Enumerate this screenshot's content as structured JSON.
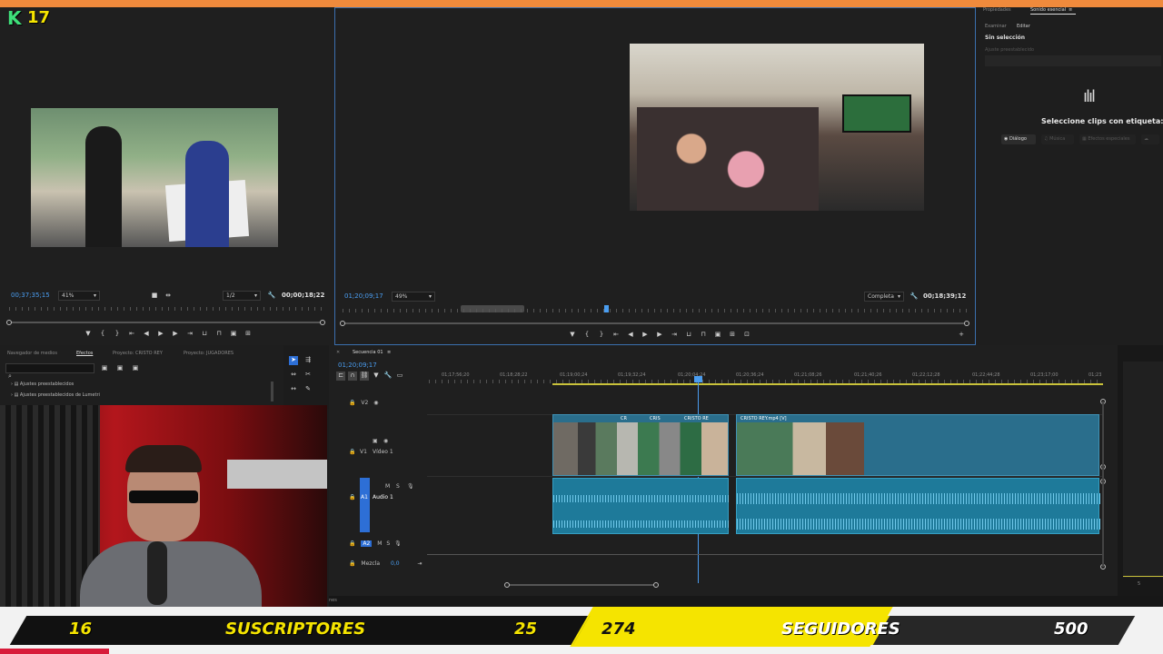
{
  "stream_overlay": {
    "logo_letter": "K",
    "logo_number": "17",
    "subs_current": "16",
    "subs_label": "SUSCRIPTORES",
    "subs_goal": "25",
    "followers_current": "274",
    "followers_label": "SEGUIDORES",
    "followers_goal": "500",
    "accent": "#f5e400"
  },
  "source_monitor": {
    "timecode_left": "00;37;35;15",
    "zoom": "41%",
    "resolution": "1/2",
    "timecode_right": "00;00;18;22"
  },
  "program_monitor": {
    "timecode_left": "01;20;09;17",
    "zoom": "49%",
    "quality": "Completa",
    "timecode_right": "00;18;39;12"
  },
  "essential_sound": {
    "tab_properties": "Propiedades",
    "tab_essential": "Sonido esencial",
    "subtab_browse": "Examinar",
    "subtab_edit": "Editar",
    "selection": "Sin selección",
    "preset_label": "Ajuste preestablecido",
    "prompt": "Seleccione clips con etiqueta:",
    "types": [
      "Diálogo",
      "Música",
      "Efectos especiales"
    ]
  },
  "effects_panel": {
    "tabs": [
      "Navegador de medios",
      "Efectos",
      "Proyecto: CRISTO REY",
      "Proyecto: JUGADORES"
    ],
    "items": [
      "Ajustes preestablecidos",
      "Ajustes preestablecidos de Lumetri"
    ],
    "search_placeholder": ""
  },
  "timeline": {
    "sequence_tab": "Secuencia 01",
    "playhead_tc": "01;20;09;17",
    "ruler_labels": [
      "01;17;56;20",
      "01;18;28;22",
      "01;19;00;24",
      "01;19;32;24",
      "01;20;04;24",
      "01;20;36;24",
      "01;21;08;26",
      "01;21;40;26",
      "01;22;12;28",
      "01;22;44;28",
      "01;23;17;00",
      "01;23"
    ],
    "tracks": {
      "v2": "V2",
      "v1": "V1",
      "v1_name": "Vídeo 1",
      "a1": "A1",
      "a1_name": "Audio 1",
      "a2": "A2",
      "mix": "Mezcla",
      "mix_value": "0,0"
    },
    "clip_labels": [
      "CR",
      "CRIS",
      "CRISTO RE",
      "CRISTO REY.mp4 [V]"
    ]
  },
  "status_text": "nes",
  "right_panel_value": "5"
}
